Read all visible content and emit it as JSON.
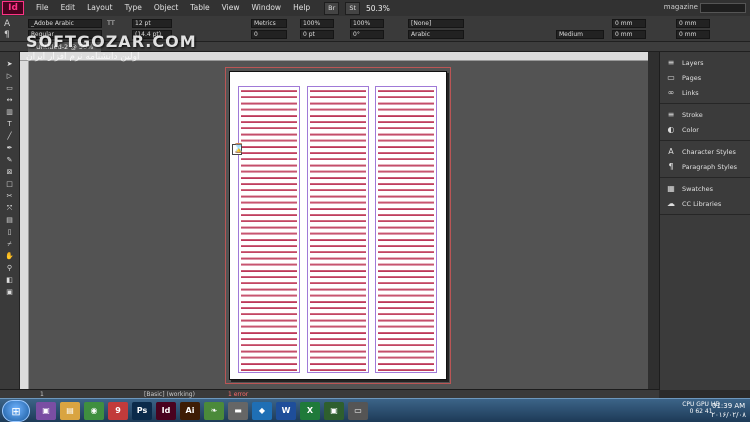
{
  "app": {
    "logo": "Id",
    "menus": [
      "File",
      "Edit",
      "Layout",
      "Type",
      "Object",
      "Table",
      "View",
      "Window",
      "Help"
    ],
    "bridge": "Br",
    "stock": "St",
    "zoom": "50.3%",
    "workspace": "magazine"
  },
  "control": {
    "font_family": "_Adobe Arabic",
    "font_style": "Regular",
    "size": "12 pt",
    "leading": "(14.4 pt)",
    "kerning": "Metrics",
    "tracking": "0",
    "scale_v": "100%",
    "scale_h": "100%",
    "baseline": "0 pt",
    "skew": "0°",
    "lang": "[None]",
    "lang2": "Arabic",
    "stroke": "Medium",
    "mm1": "0 mm",
    "mm2": "0 mm",
    "mm3": "0 mm",
    "mm4": "0 mm",
    "tt_label": "TT",
    "t_label": "T"
  },
  "tab": {
    "label": "Untitled-2 @ 50%"
  },
  "watermark": {
    "title": "SOFTGOZAR.COM",
    "subtitle": "اولین دانشنامه نرم افزار ایران"
  },
  "panels": [
    {
      "items": [
        {
          "name": "layers",
          "label": "Layers",
          "icon": "≡"
        },
        {
          "name": "pages",
          "label": "Pages",
          "icon": "▭"
        },
        {
          "name": "links",
          "label": "Links",
          "icon": "∞"
        }
      ]
    },
    {
      "items": [
        {
          "name": "stroke",
          "label": "Stroke",
          "icon": "≡"
        },
        {
          "name": "color",
          "label": "Color",
          "icon": "◐"
        }
      ]
    },
    {
      "items": [
        {
          "name": "character-styles",
          "label": "Character Styles",
          "icon": "A"
        },
        {
          "name": "paragraph-styles",
          "label": "Paragraph Styles",
          "icon": "¶"
        }
      ]
    },
    {
      "items": [
        {
          "name": "swatches",
          "label": "Swatches",
          "icon": "▦"
        },
        {
          "name": "cc-libraries",
          "label": "CC Libraries",
          "icon": "☁"
        }
      ]
    }
  ],
  "status": {
    "page": "1",
    "style": "[Basic] (working)",
    "errors": "1 error"
  },
  "taskbar": {
    "apps": [
      {
        "n": "explorer",
        "l": "▣",
        "c": "#7a4ea3"
      },
      {
        "n": "folder",
        "l": "▤",
        "c": "#d9a441"
      },
      {
        "n": "chrome",
        "l": "◉",
        "c": "#3f8f3f"
      },
      {
        "n": "app9",
        "l": "9",
        "c": "#c23b3b"
      },
      {
        "n": "photoshop",
        "l": "Ps",
        "c": "#0b2a4a"
      },
      {
        "n": "indesign",
        "l": "Id",
        "c": "#49021f"
      },
      {
        "n": "illustrator",
        "l": "Ai",
        "c": "#3e1d05"
      },
      {
        "n": "leaf",
        "l": "❧",
        "c": "#4b8a3a"
      },
      {
        "n": "gray",
        "l": "▬",
        "c": "#666"
      },
      {
        "n": "shield",
        "l": "◆",
        "c": "#1f6fb5"
      },
      {
        "n": "word",
        "l": "W",
        "c": "#1e4e9a"
      },
      {
        "n": "excel",
        "l": "X",
        "c": "#1f7a3a"
      },
      {
        "n": "monitor",
        "l": "▣",
        "c": "#2e5f2e"
      },
      {
        "n": "capture",
        "l": "▭",
        "c": "#555"
      }
    ],
    "tray": "CPU GPU HD",
    "tray_vals": "0   62  41",
    "time": "01:39 AM",
    "date": "۲۰۱۶/۰۲/۰۸"
  }
}
